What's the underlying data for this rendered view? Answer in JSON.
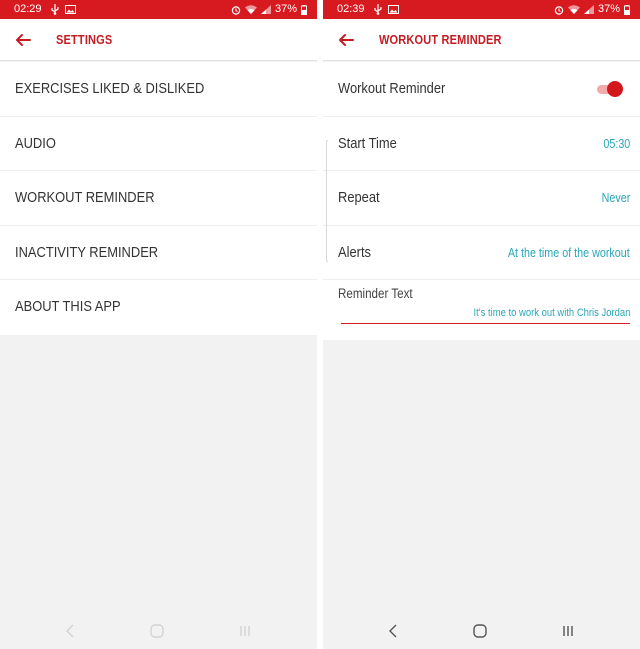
{
  "left_screen": {
    "status_bar": {
      "time": "02:29",
      "battery": "37%",
      "icons": [
        "usb-icon",
        "image-icon",
        "alarm-icon",
        "wifi-icon",
        "signal-icon",
        "battery-icon"
      ]
    },
    "app_bar": {
      "title": "SETTINGS",
      "back_icon": "arrow-left-icon"
    },
    "items": [
      {
        "label": "EXERCISES LIKED & DISLIKED"
      },
      {
        "label": "AUDIO"
      },
      {
        "label": "WORKOUT REMINDER"
      },
      {
        "label": "INACTIVITY REMINDER"
      },
      {
        "label": "ABOUT THIS APP"
      }
    ],
    "nav_bar": {
      "icons": [
        "back-icon",
        "home-icon",
        "recents-icon"
      ]
    }
  },
  "right_screen": {
    "status_bar": {
      "time": "02:39",
      "battery": "37%",
      "icons": [
        "usb-icon",
        "image-icon",
        "alarm-icon",
        "wifi-icon",
        "signal-icon",
        "battery-icon"
      ]
    },
    "app_bar": {
      "title": "WORKOUT REMINDER",
      "back_icon": "arrow-left-icon"
    },
    "workout_reminder": {
      "label": "Workout Reminder",
      "enabled": true
    },
    "start_time": {
      "label": "Start Time",
      "value": "05:30"
    },
    "repeat": {
      "label": "Repeat",
      "value": "Never"
    },
    "alerts": {
      "label": "Alerts",
      "value": "At the time of the workout"
    },
    "reminder_text": {
      "label": "Reminder Text",
      "value": "It's time to work out with Chris Jordan"
    },
    "nav_bar": {
      "icons": [
        "back-icon",
        "home-icon",
        "recents-icon"
      ]
    }
  },
  "colors": {
    "status_bar": "#d71a1f",
    "accent": "#c41c23",
    "value_text": "#29a6b8",
    "background": "#f2f2f2"
  }
}
